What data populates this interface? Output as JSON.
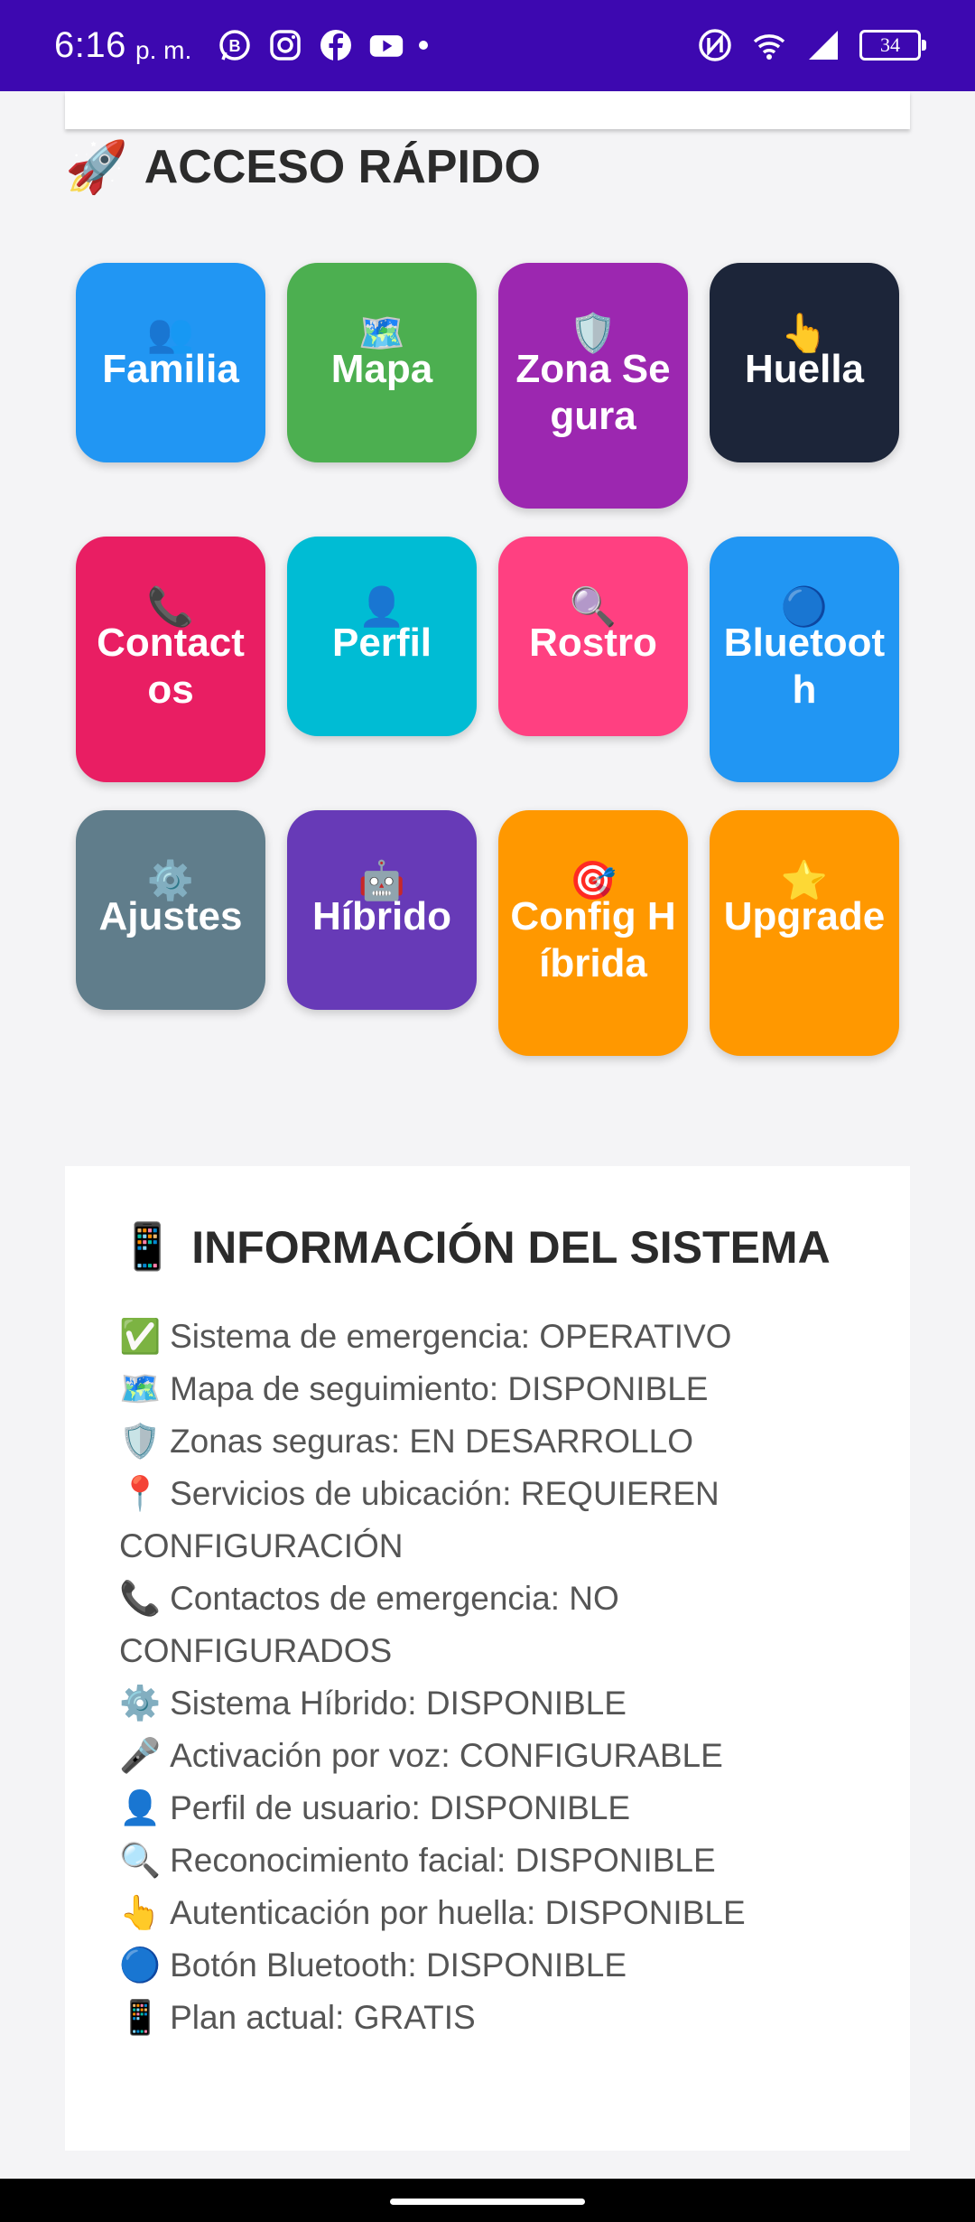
{
  "status_bar": {
    "time": "6:16",
    "ampm": "p. m.",
    "battery": "34",
    "left_icons": [
      "whatsapp-business-icon",
      "instagram-icon",
      "facebook-icon",
      "youtube-icon"
    ],
    "right_icons": [
      "nfc-icon",
      "wifi-icon",
      "signal-icon",
      "battery-icon"
    ]
  },
  "quick_access": {
    "emoji": "🚀",
    "title": "ACCESO RÁPIDO",
    "tiles": [
      {
        "emoji": "👥",
        "label": "Familia",
        "color": "#2196f3"
      },
      {
        "emoji": "🗺️",
        "label": "Mapa",
        "color": "#4caf50"
      },
      {
        "emoji": "🛡️",
        "label": "Zona Segura",
        "color": "#9c27b0"
      },
      {
        "emoji": "👆",
        "label": "Huella",
        "color": "#1c2539"
      },
      {
        "emoji": "📞",
        "label": "Contactos",
        "color": "#e91e63"
      },
      {
        "emoji": "👤",
        "label": "Perfil",
        "color": "#00bcd4"
      },
      {
        "emoji": "🔍",
        "label": "Rostro",
        "color": "#ff4081"
      },
      {
        "emoji": "🔵",
        "label": "Bluetooth",
        "color": "#2196f3"
      },
      {
        "emoji": "⚙️",
        "label": "Ajustes",
        "color": "#607d8b"
      },
      {
        "emoji": "🤖",
        "label": "Híbrido",
        "color": "#673ab7"
      },
      {
        "emoji": "🎯",
        "label": "Config Híbrida",
        "color": "#ff9800"
      },
      {
        "emoji": "⭐",
        "label": "Upgrade",
        "color": "#ff9800"
      }
    ]
  },
  "system_info": {
    "emoji": "📱",
    "title": "INFORMACIÓN DEL SISTEMA",
    "items": [
      {
        "emoji": "✅",
        "text": "Sistema de emergencia: OPERATIVO"
      },
      {
        "emoji": "🗺️",
        "text": "Mapa de seguimiento: DISPONIBLE"
      },
      {
        "emoji": "🛡️",
        "text": "Zonas seguras: EN DESARROLLO"
      },
      {
        "emoji": "📍",
        "text": "Servicios de ubicación: REQUIEREN CONFIGURACIÓN"
      },
      {
        "emoji": "📞",
        "text": "Contactos de emergencia: NO CONFIGURADOS"
      },
      {
        "emoji": "⚙️",
        "text": "Sistema Híbrido: DISPONIBLE"
      },
      {
        "emoji": "🎤",
        "text": "Activación por voz: CONFIGURABLE"
      },
      {
        "emoji": "👤",
        "text": "Perfil de usuario: DISPONIBLE"
      },
      {
        "emoji": "🔍",
        "text": "Reconocimiento facial: DISPONIBLE"
      },
      {
        "emoji": "👆",
        "text": "Autenticación por huella: DISPONIBLE"
      },
      {
        "emoji": "🔵",
        "text": "Botón Bluetooth: DISPONIBLE"
      },
      {
        "emoji": "📱",
        "text": "Plan actual: GRATIS"
      }
    ]
  }
}
